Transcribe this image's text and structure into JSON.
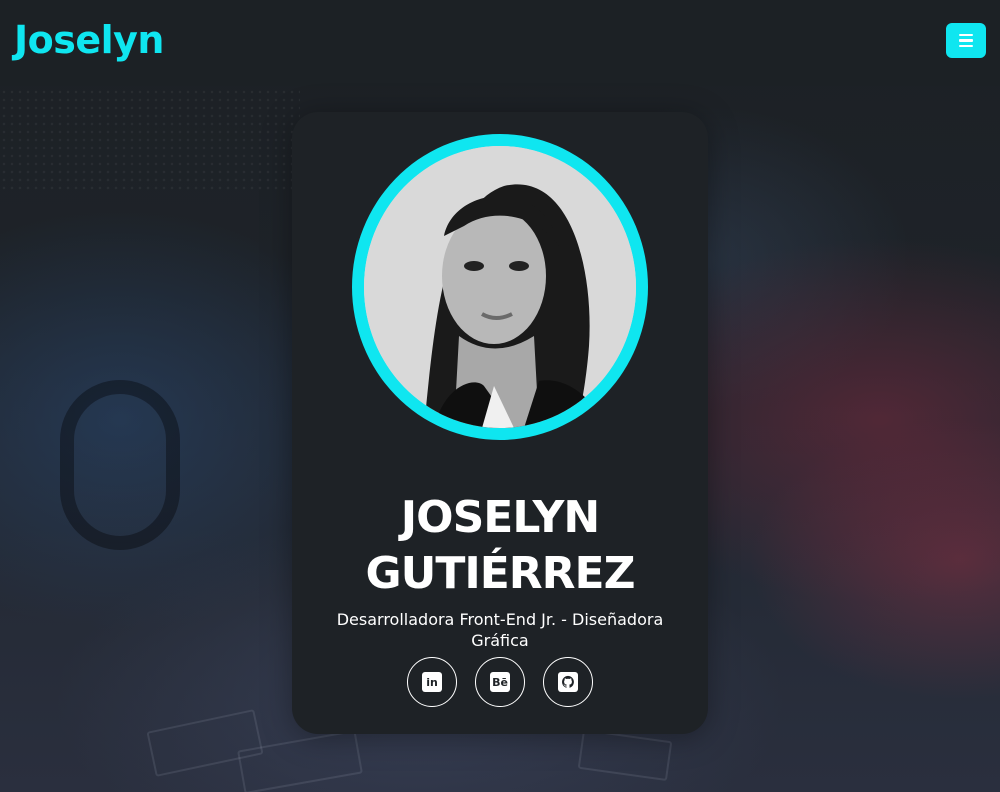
{
  "nav": {
    "logo_text": "Joselyn",
    "menu_icon": "hamburger-icon"
  },
  "profile": {
    "name_line1": "JOSELYN",
    "name_line2": "GUTIÉRREZ",
    "subtitle": "Desarrolladora Front-End Jr. - Diseñadora Gráfica",
    "photo": "profile-photo"
  },
  "socials": [
    {
      "icon": "linkedin-icon",
      "glyph": "in"
    },
    {
      "icon": "behance-icon",
      "glyph": "Bē"
    },
    {
      "icon": "github-icon",
      "glyph": ""
    }
  ],
  "colors": {
    "accent": "#0fe6f0",
    "card_bg": "#1e2226",
    "page_bg": "#1b2024",
    "text": "#ffffff"
  }
}
